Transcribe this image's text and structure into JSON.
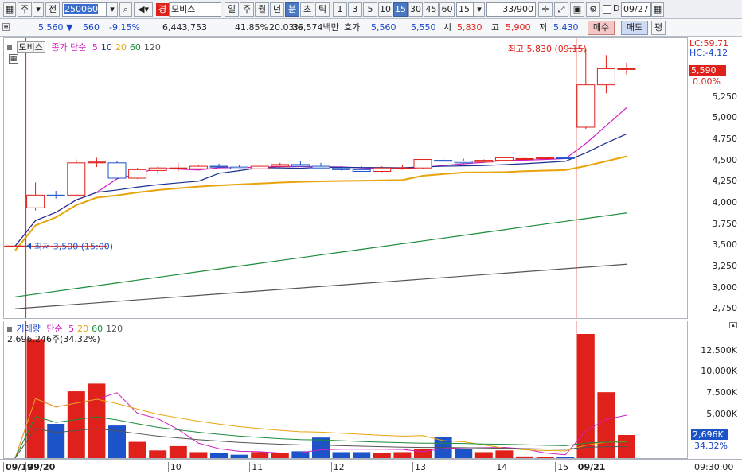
{
  "toolbar": {
    "market_type": "주",
    "prev_label": "전",
    "code": "250060",
    "stock_badge": "경",
    "stock_name": "모비스",
    "period_buttons": [
      "일",
      "주",
      "월",
      "년",
      "분",
      "초",
      "틱"
    ],
    "active_period": "분",
    "interval_buttons": [
      "1",
      "3",
      "5",
      "10",
      "15",
      "30",
      "45",
      "60"
    ],
    "active_interval": "15",
    "interval_value": "15",
    "count": "33",
    "count_total": "/900",
    "date": "09/27"
  },
  "quote": {
    "price": "5,560",
    "change_arrow": "▼",
    "change": "560",
    "change_pct": "-9.15%",
    "volume": "6,443,753",
    "vol_ratio": "41.85%",
    "turnover_rate": "20.03%",
    "amount": "36,574백만",
    "hoga_label": "호가",
    "hoga_sell": "5,560",
    "hoga_buy": "5,550",
    "open_label": "시",
    "open": "5,830",
    "high_label": "고",
    "high": "5,900",
    "low_label": "저",
    "low": "5,430",
    "buy_button": "매수",
    "sell_button": "매도",
    "eval_button": "평"
  },
  "price_panel": {
    "name": "모비스",
    "ma_title": "종가 단순",
    "ma_periods": [
      "5",
      "10",
      "20",
      "60",
      "120"
    ],
    "lc": "LC:59.71",
    "hc": "HC:-4.12",
    "current_price_tag": "5,590",
    "current_pct_tag": "0.00%",
    "high_annotation": "최고 5,830 (09:15)",
    "low_annotation": "최저 3,500 (15:00)",
    "y_ticks": [
      "5,250",
      "5,000",
      "4,750",
      "4,500",
      "4,250",
      "4,000",
      "3,750",
      "3,500",
      "3,250",
      "3,000",
      "2,750"
    ]
  },
  "volume_panel": {
    "title": "거래량",
    "ma_title": "단순",
    "ma_periods": [
      "5",
      "20",
      "60",
      "120"
    ],
    "summary": "2,696,246주(34.32%)",
    "y_ticks": [
      "12,500K",
      "10,000K",
      "7,500K",
      "5,000K"
    ],
    "current_tag": "2,696K",
    "current_pct": "34.32%"
  },
  "time_axis": {
    "labels": [
      "09/19",
      "09/20",
      "10",
      "11",
      "12",
      "13",
      "14",
      "15",
      "09/21"
    ],
    "time": "09:30:00"
  },
  "chart_data": {
    "type": "candlestick",
    "title": "모비스",
    "x": [
      "09/19 15:00",
      "09/20 09:00",
      "09:15",
      "09:30",
      "09:45",
      "10:00",
      "10:15",
      "10:30",
      "10:45",
      "11:00",
      "11:15",
      "11:30",
      "11:45",
      "12:00",
      "12:15",
      "12:30",
      "12:45",
      "13:00",
      "13:15",
      "13:30",
      "13:45",
      "14:00",
      "14:15",
      "14:30",
      "14:45",
      "15:00",
      "15:15",
      "15:30",
      "09/21 09:00",
      "09:15",
      "09:30"
    ],
    "candles": [
      {
        "o": 3500,
        "h": 3500,
        "l": 3500,
        "c": 3500
      },
      {
        "o": 3950,
        "h": 4250,
        "l": 3920,
        "c": 4100
      },
      {
        "o": 4100,
        "h": 4150,
        "l": 4060,
        "c": 4090
      },
      {
        "o": 4100,
        "h": 4520,
        "l": 4090,
        "c": 4480
      },
      {
        "o": 4480,
        "h": 4540,
        "l": 4430,
        "c": 4490
      },
      {
        "o": 4480,
        "h": 4500,
        "l": 4290,
        "c": 4300
      },
      {
        "o": 4300,
        "h": 4420,
        "l": 4290,
        "c": 4400
      },
      {
        "o": 4390,
        "h": 4440,
        "l": 4350,
        "c": 4420
      },
      {
        "o": 4420,
        "h": 4480,
        "l": 4380,
        "c": 4420
      },
      {
        "o": 4410,
        "h": 4460,
        "l": 4400,
        "c": 4440
      },
      {
        "o": 4440,
        "h": 4470,
        "l": 4420,
        "c": 4430
      },
      {
        "o": 4430,
        "h": 4450,
        "l": 4400,
        "c": 4410
      },
      {
        "o": 4410,
        "h": 4460,
        "l": 4400,
        "c": 4440
      },
      {
        "o": 4440,
        "h": 4480,
        "l": 4430,
        "c": 4460
      },
      {
        "o": 4460,
        "h": 4500,
        "l": 4440,
        "c": 4440
      },
      {
        "o": 4440,
        "h": 4480,
        "l": 4420,
        "c": 4420
      },
      {
        "o": 4420,
        "h": 4440,
        "l": 4390,
        "c": 4400
      },
      {
        "o": 4400,
        "h": 4440,
        "l": 4380,
        "c": 4380
      },
      {
        "o": 4380,
        "h": 4440,
        "l": 4370,
        "c": 4420
      },
      {
        "o": 4420,
        "h": 4450,
        "l": 4400,
        "c": 4420
      },
      {
        "o": 4420,
        "h": 4520,
        "l": 4410,
        "c": 4520
      },
      {
        "o": 4510,
        "h": 4540,
        "l": 4500,
        "c": 4500
      },
      {
        "o": 4500,
        "h": 4530,
        "l": 4470,
        "c": 4480
      },
      {
        "o": 4490,
        "h": 4520,
        "l": 4480,
        "c": 4510
      },
      {
        "o": 4510,
        "h": 4540,
        "l": 4500,
        "c": 4540
      },
      {
        "o": 4530,
        "h": 4540,
        "l": 4520,
        "c": 4530
      },
      {
        "o": 4530,
        "h": 4540,
        "l": 4520,
        "c": 4540
      },
      {
        "o": 4540,
        "h": 4540,
        "l": 4530,
        "c": 4530
      },
      {
        "o": 4900,
        "h": 5830,
        "l": 4880,
        "c": 5400
      },
      {
        "o": 5400,
        "h": 5750,
        "l": 5300,
        "c": 5590
      },
      {
        "o": 5590,
        "h": 5660,
        "l": 5520,
        "c": 5590
      }
    ],
    "volume_k": [
      0,
      13900,
      4000,
      7800,
      8700,
      3800,
      1900,
      900,
      1400,
      700,
      600,
      400,
      700,
      600,
      800,
      2400,
      700,
      700,
      600,
      700,
      1100,
      2500,
      1100,
      700,
      900,
      200,
      100,
      100,
      14500,
      7700,
      2696
    ],
    "ylim": [
      2650,
      5950
    ],
    "volume_ylim": [
      0,
      14500
    ]
  },
  "colors": {
    "up": "#e0201a",
    "down": "#1d53c9",
    "ma5": "#d21fc2",
    "ma10": "#1b2f8f",
    "ma20": "#e8a40c",
    "ma60": "#1c8c3c",
    "ma120": "#555555"
  }
}
